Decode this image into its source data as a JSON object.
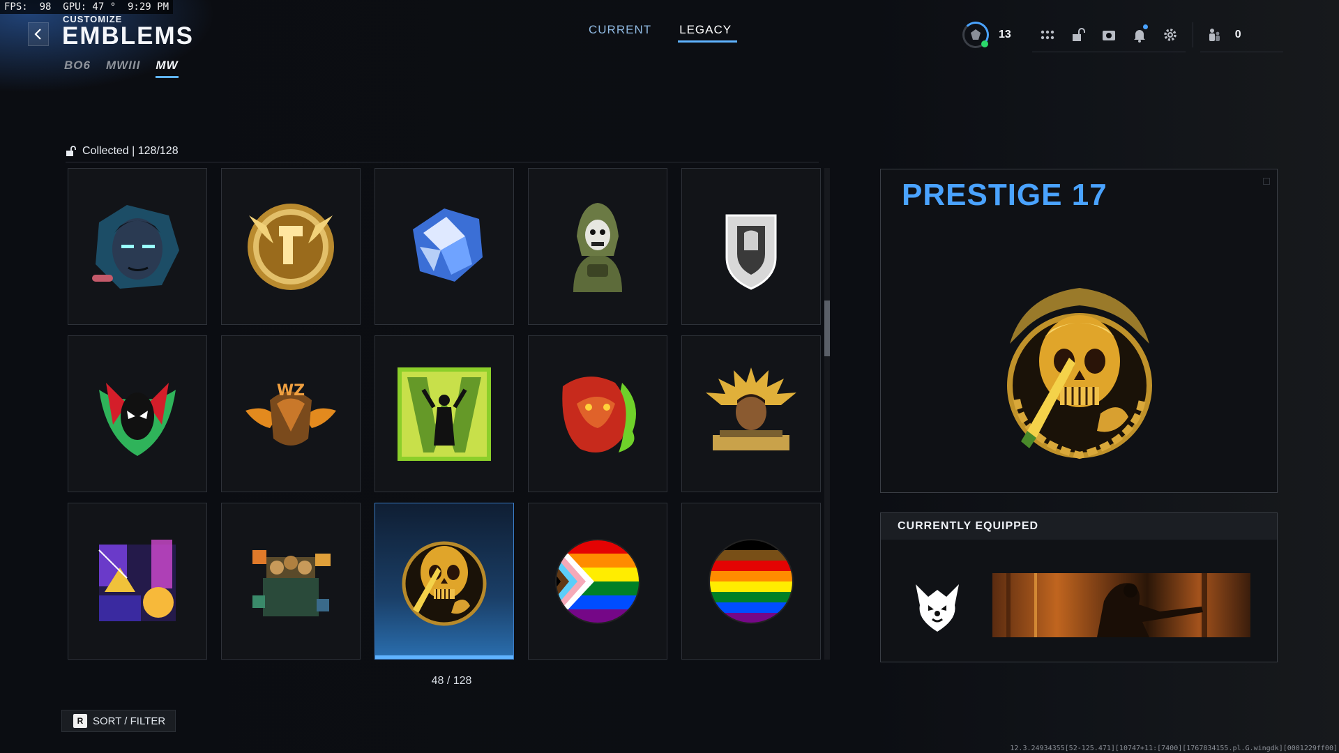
{
  "debug": {
    "overlay": "FPS:  98  GPU: 47 °  9:29 PM"
  },
  "header": {
    "subtitle": "CUSTOMIZE",
    "title": "EMBLEMS",
    "game_tabs": [
      {
        "label": "BO6",
        "active": false
      },
      {
        "label": "MWIII",
        "active": false
      },
      {
        "label": "MW",
        "active": true
      }
    ],
    "mode_tabs": [
      {
        "label": "CURRENT",
        "active": false
      },
      {
        "label": "LEGACY",
        "active": true
      }
    ]
  },
  "hud": {
    "level": "13",
    "party_count": "0",
    "icons": [
      "apps-grid-icon",
      "unlock-icon",
      "store-icon",
      "bell-icon",
      "gear-icon"
    ]
  },
  "collection": {
    "label": "Collected | 128/128",
    "pager": "48 / 128"
  },
  "emblems": [
    {
      "name": "neon-face-emblem",
      "selected": false
    },
    {
      "name": "gold-g-wings-emblem",
      "selected": false
    },
    {
      "name": "shattered-crystal-emblem",
      "selected": false
    },
    {
      "name": "ghost-camo-operator-emblem",
      "selected": false
    },
    {
      "name": "spartan-shield-emblem",
      "selected": false
    },
    {
      "name": "spawn-mask-emblem",
      "selected": false
    },
    {
      "name": "wz-parachute-emblem",
      "selected": false
    },
    {
      "name": "green-w-soldier-emblem",
      "selected": false
    },
    {
      "name": "red-beast-flames-emblem",
      "selected": false
    },
    {
      "name": "gold-operator-emblem",
      "selected": false
    },
    {
      "name": "city-collage-emblem",
      "selected": false
    },
    {
      "name": "pixel-squad-emblem",
      "selected": false
    },
    {
      "name": "prestige-17-skull-emblem",
      "selected": true
    },
    {
      "name": "progress-pride-circle-emblem",
      "selected": false
    },
    {
      "name": "rainbow-pride-circle-emblem",
      "selected": false
    }
  ],
  "preview": {
    "title": "PRESTIGE 17"
  },
  "equipped": {
    "header": "CURRENTLY EQUIPPED"
  },
  "footer": {
    "sort_key": "R",
    "sort_label": "SORT / FILTER",
    "build": "12.3.24934355[52-125.471][10747+11:[7400][1767834155.pl.G.wingdk][0001229ff00]"
  },
  "colors": {
    "accent": "#4aa3ff",
    "online": "#2bd96b",
    "background": "#0b0d12"
  }
}
